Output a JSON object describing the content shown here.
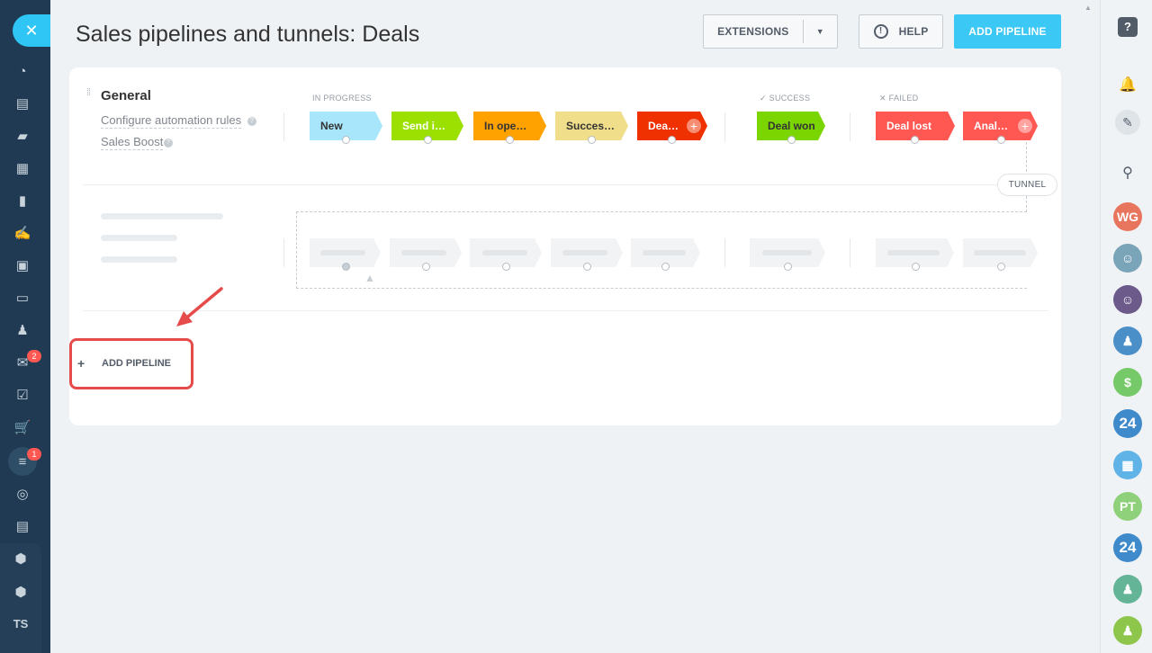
{
  "header": {
    "title": "Sales pipelines and tunnels: Deals",
    "extensions_label": "EXTENSIONS",
    "help_label": "HELP",
    "add_pipeline_label": "ADD PIPELINE"
  },
  "pipeline": {
    "name": "General",
    "links": [
      "Configure automation rules",
      "Sales Boost"
    ],
    "groups": {
      "in_progress": "IN PROGRESS",
      "success": "SUCCESS",
      "failed": "FAILED"
    },
    "stages": [
      {
        "label": "New",
        "color": "#a8e6fb"
      },
      {
        "label": "Send i…",
        "color": "#9be000"
      },
      {
        "label": "In ope…",
        "color": "#ffa200"
      },
      {
        "label": "Succes…",
        "color": "#f1de8a"
      },
      {
        "label": "Dea…",
        "color": "#ef3000"
      },
      {
        "label": "Deal won",
        "color": "#7bd500"
      },
      {
        "label": "Deal lost",
        "color": "#ff5752"
      },
      {
        "label": "Anal…",
        "color": "#ff5752"
      }
    ],
    "tunnel_label": "TUNNEL"
  },
  "footer": {
    "add_pipeline_label": "ADD PIPELINE"
  },
  "left_sidebar": {
    "badges": [
      "2",
      "1"
    ],
    "bottom_label": "TS"
  },
  "right_sidebar": {
    "avatars": [
      "WG",
      "PT"
    ],
    "b24_label": "24"
  },
  "icons": {
    "close": "close-icon",
    "help": "help-icon",
    "bell": "bell-icon",
    "chat": "chat-icon",
    "search": "search-icon"
  }
}
